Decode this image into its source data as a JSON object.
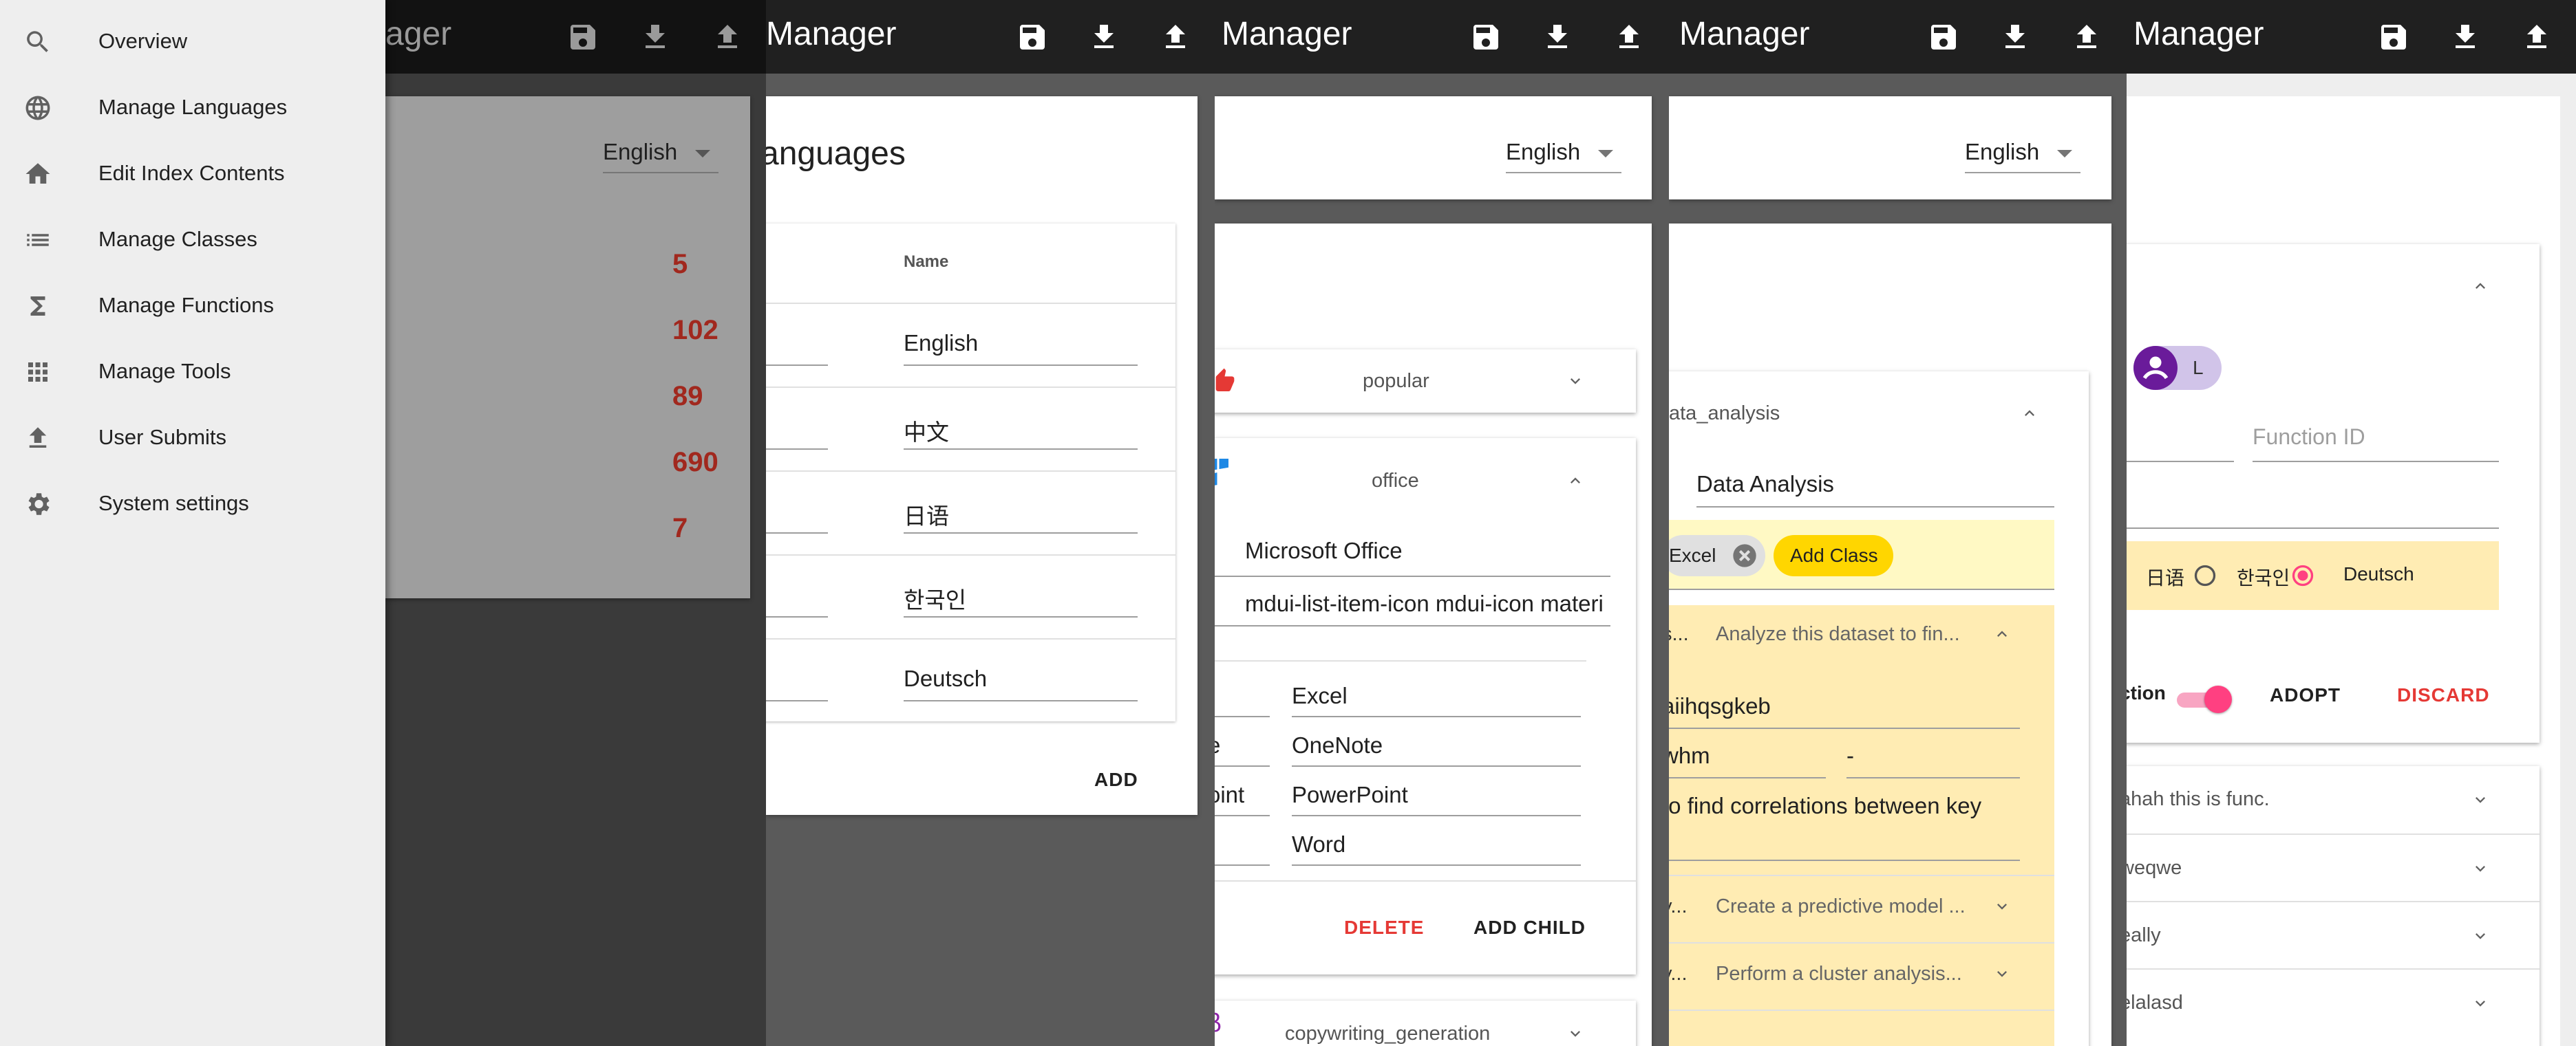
{
  "app": {
    "title_full": "Manager",
    "title_partial": "ager",
    "toolbar": {
      "save": "save-icon",
      "download": "download-icon",
      "upload": "upload-icon"
    }
  },
  "drawer": {
    "items": [
      {
        "label": "Overview",
        "icon": "search-icon"
      },
      {
        "label": "Manage Languages",
        "icon": "globe-icon"
      },
      {
        "label": "Edit Index Contents",
        "icon": "home-icon"
      },
      {
        "label": "Manage Classes",
        "icon": "list-icon"
      },
      {
        "label": "Manage Functions",
        "icon": "sigma-icon"
      },
      {
        "label": "Manage Tools",
        "icon": "apps-icon"
      },
      {
        "label": "User Submits",
        "icon": "upload-icon"
      },
      {
        "label": "System settings",
        "icon": "gear-icon"
      }
    ]
  },
  "language_select": {
    "value": "English"
  },
  "overview": {
    "counts": [
      "5",
      "102",
      "89",
      "690",
      "7"
    ]
  },
  "languages": {
    "title": "anguages",
    "column_name": "Name",
    "rows": [
      "English",
      "中文",
      "日语",
      "한국인",
      "Deutsch"
    ],
    "add_label": "ADD"
  },
  "classes": {
    "popular": "popular",
    "office": "office",
    "office_name": "Microsoft Office",
    "office_icon_class": "mdui-list-item-icon mdui-icon materi",
    "children": [
      {
        "label": "",
        "value": "Excel"
      },
      {
        "label": "e",
        "value": "OneNote"
      },
      {
        "label": "oint",
        "value": "PowerPoint"
      },
      {
        "label": "",
        "value": "Word"
      }
    ],
    "delete_label": "DELETE",
    "add_child_label": "ADD CHILD",
    "copywriting": "copywriting_generation"
  },
  "functions": {
    "category_key": "ata_analysis",
    "category_name": "Data Analysis",
    "chip_excel": "Excel",
    "add_class_label": "Add Class",
    "items": [
      {
        "prefix": "s...",
        "summary": "Analyze this dataset to fin..."
      },
      {
        "prefix": "y...",
        "summary": "Create a predictive model ..."
      },
      {
        "prefix": "y...",
        "summary": "Perform a cluster analysis..."
      }
    ],
    "detail_id": "aiihqsgkeb",
    "detail_a": "whm",
    "detail_b": "-",
    "detail_text": "to find correlations between key"
  },
  "submits": {
    "avatar_letter": "L",
    "function_id_placeholder": "Function ID",
    "radio_labels": [
      "日语",
      "한국인",
      "Deutsch"
    ],
    "toggle_label": "ction",
    "adopt_label": "ADOPT",
    "discard_label": "DISCARD",
    "list": [
      "ahah this is func.",
      "weqwe",
      "eally",
      "elalasd"
    ]
  },
  "colors": {
    "accent": "#ff4081",
    "chip_yellow": "#ffd600",
    "panel_yellow": "#ffecb3",
    "number_red": "#a1281e"
  }
}
